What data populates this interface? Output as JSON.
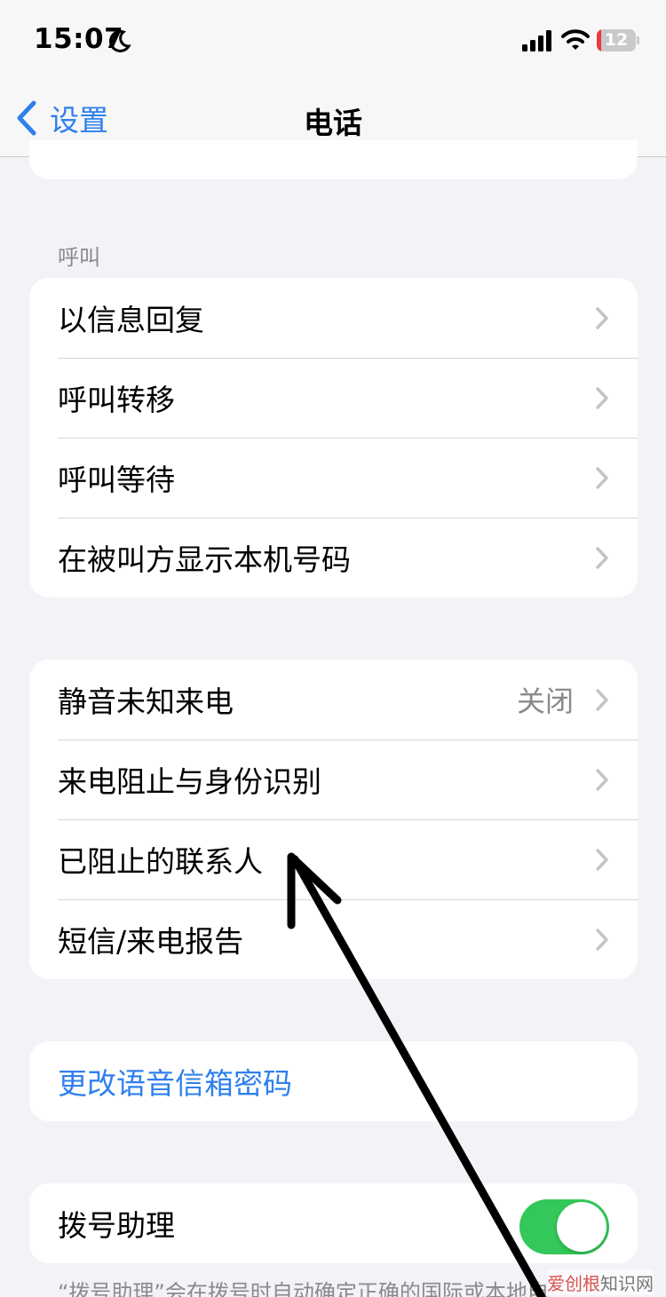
{
  "status_bar": {
    "time": "15:07",
    "battery": "12",
    "battery_level": 0.12
  },
  "nav": {
    "back_label": "设置",
    "title": "电话"
  },
  "sections": {
    "calls_header": "呼叫",
    "calls": [
      {
        "label": "以信息回复"
      },
      {
        "label": "呼叫转移"
      },
      {
        "label": "呼叫等待"
      },
      {
        "label": "在被叫方显示本机号码"
      }
    ],
    "blocking": [
      {
        "label": "静音未知来电",
        "value": "关闭"
      },
      {
        "label": "来电阻止与身份识别"
      },
      {
        "label": "已阻止的联系人"
      },
      {
        "label": "短信/来电报告"
      }
    ],
    "voicemail": {
      "label": "更改语音信箱密码"
    },
    "dial_assist": {
      "label": "拨号助理",
      "enabled": true
    },
    "dial_assist_footer": "“拨号助理”会在拨号时自动确定正确的国际或本地电"
  },
  "watermark": {
    "brand": "爱创根",
    "suffix": "知识网"
  },
  "colors": {
    "accent": "#2f80ed",
    "toggle_on": "#34c759",
    "background": "#f2f2f7",
    "secondary_text": "#8a8a8e"
  }
}
